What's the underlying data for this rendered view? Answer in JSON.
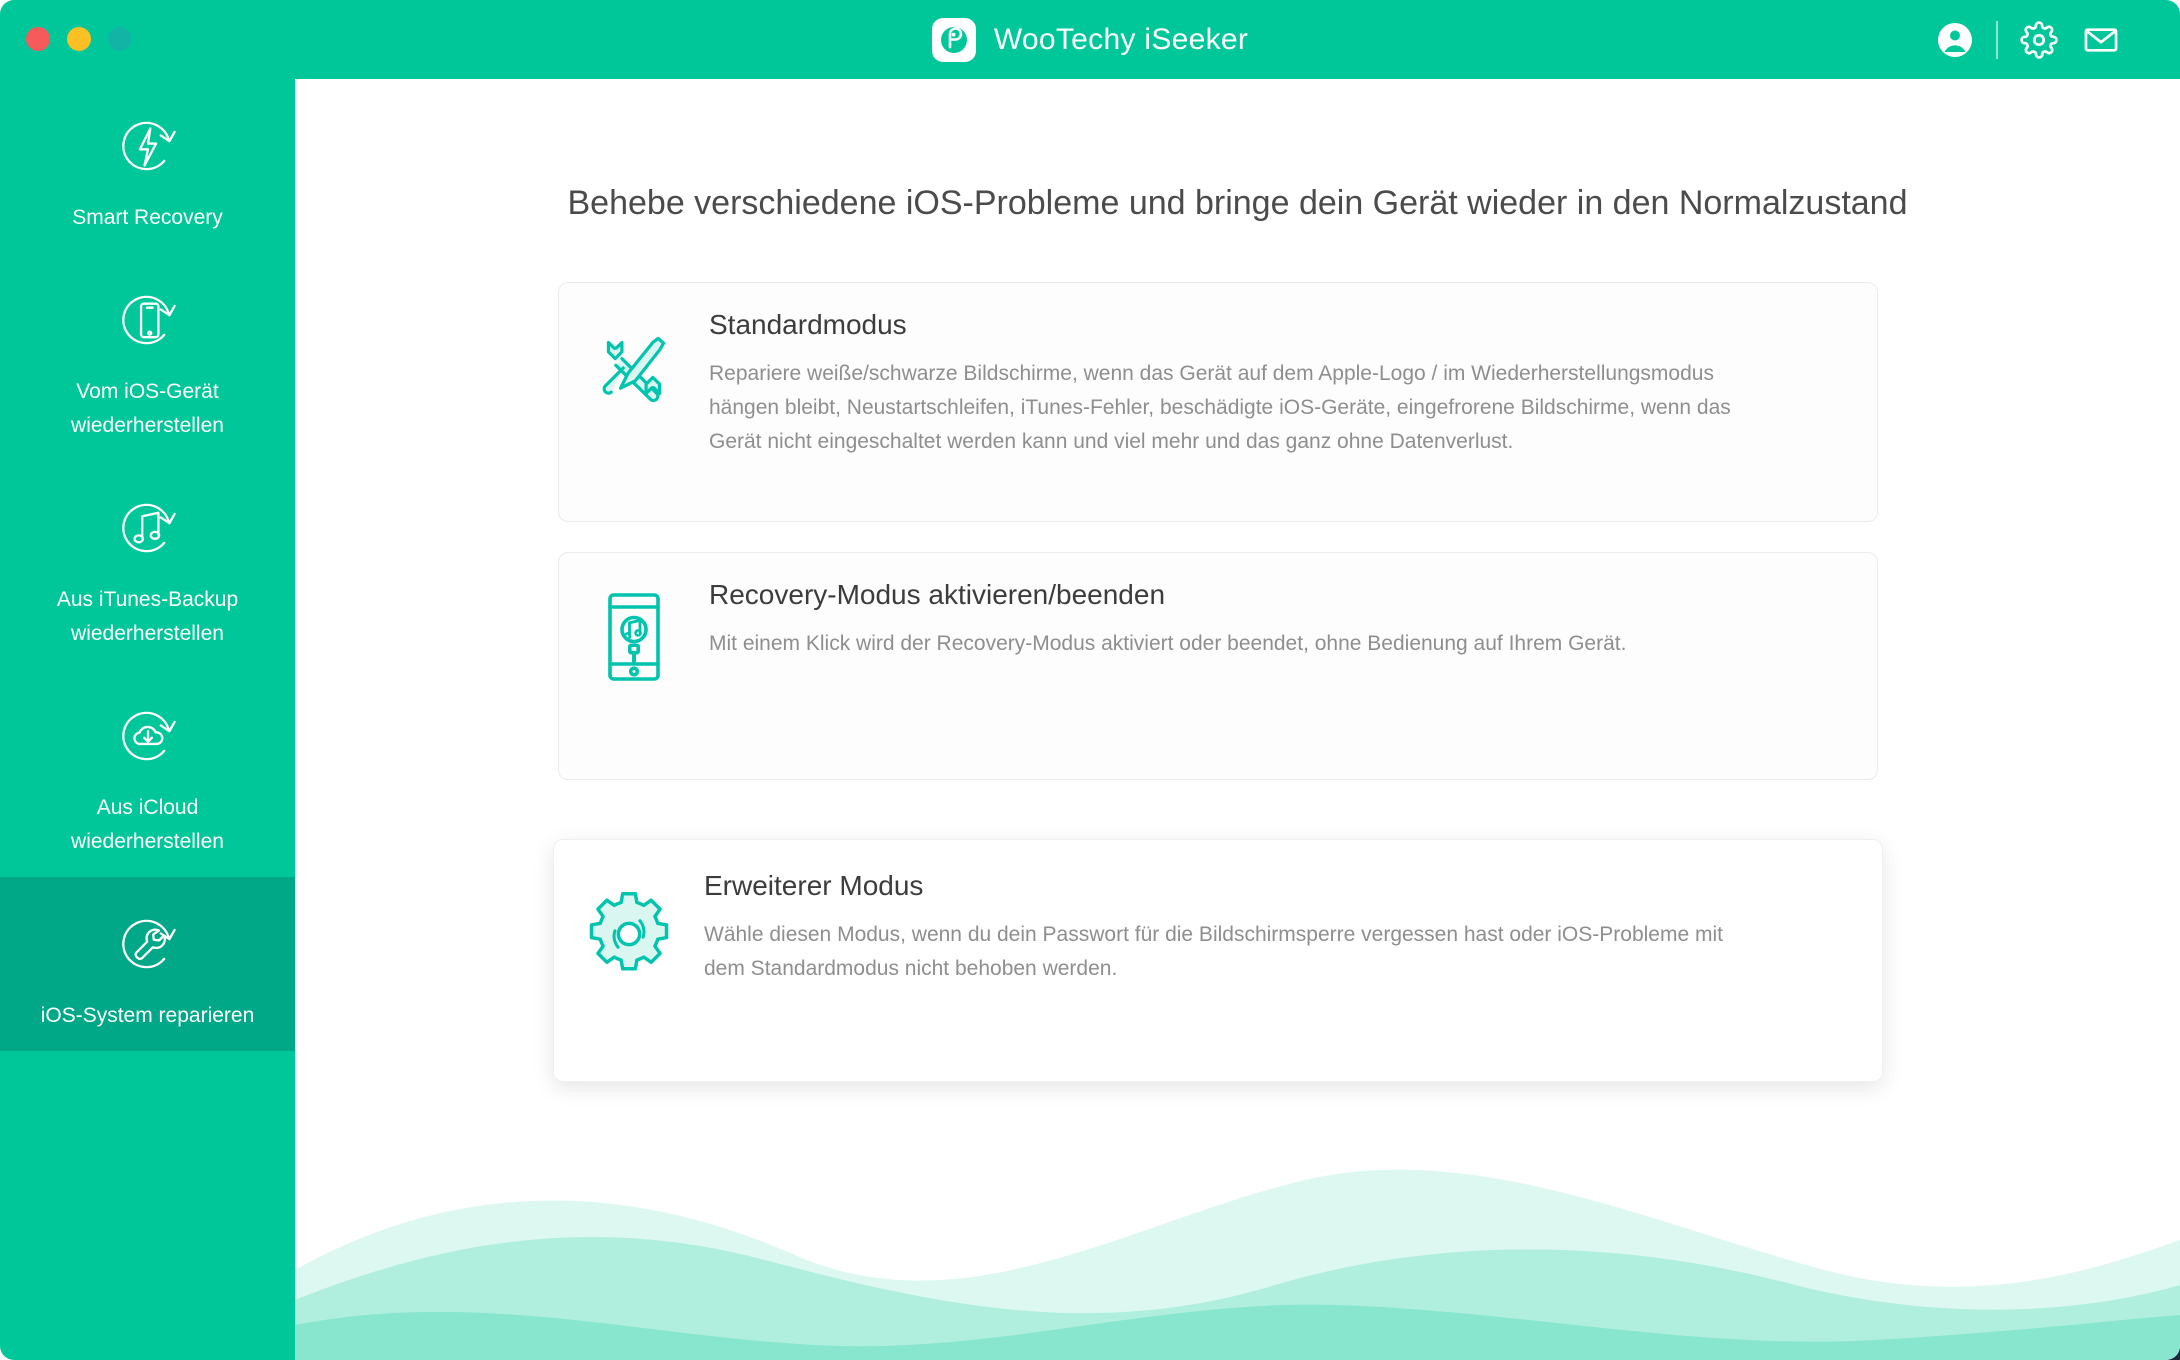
{
  "window": {
    "traffic_lights": [
      {
        "name": "close",
        "color": "#f75a5a"
      },
      {
        "name": "minimize",
        "color": "#fcc024"
      },
      {
        "name": "maximize",
        "color": "#12b5a5"
      }
    ],
    "accent_color": "#00c79a",
    "accent_active_color": "#00a887"
  },
  "titlebar": {
    "app_title": "WooTechy iSeeker",
    "actions": [
      {
        "name": "account",
        "icon": "user-circle-icon"
      },
      {
        "name": "settings",
        "icon": "gear-icon"
      },
      {
        "name": "feedback",
        "icon": "envelope-icon"
      }
    ]
  },
  "sidebar": {
    "items": [
      {
        "label": "Smart Recovery",
        "icon": "lightning-refresh-icon",
        "active": false
      },
      {
        "label": "Vom iOS-Gerät wiederherstellen",
        "icon": "phone-refresh-icon",
        "active": false
      },
      {
        "label": "Aus iTunes-Backup wiederherstellen",
        "icon": "music-refresh-icon",
        "active": false
      },
      {
        "label": "Aus iCloud wiederherstellen",
        "icon": "cloud-download-refresh-icon",
        "active": false
      },
      {
        "label": "iOS-System reparieren",
        "icon": "wrench-refresh-icon",
        "active": true
      }
    ]
  },
  "main": {
    "page_title": "Behebe verschiedene iOS-Probleme und bringe dein Gerät wieder in den Normalzustand",
    "cards": [
      {
        "id": "standard-mode",
        "icon": "wrench-screwdriver-icon",
        "title": "Standardmodus",
        "description": "Repariere weiße/schwarze Bildschirme, wenn das Gerät auf dem Apple-Logo / im Wiederherstellungsmodus hängen bleibt, Neustartschleifen, iTunes-Fehler, beschädigte iOS-Geräte, eingefrorene Bildschirme, wenn das Gerät nicht eingeschaltet werden kann und viel mehr und das ganz ohne Datenverlust."
      },
      {
        "id": "recovery-mode",
        "icon": "phone-itunes-cable-icon",
        "title": "Recovery-Modus aktivieren/beenden",
        "description": "Mit einem Klick wird der Recovery-Modus aktiviert oder beendet, ohne Bedienung auf Ihrem Gerät."
      },
      {
        "id": "advanced-mode",
        "icon": "gear-settings-icon",
        "title": "Erweiterer Modus",
        "description": "Wähle diesen Modus, wenn du dein Passwort für die Bildschirmsperre vergessen hast oder iOS-Probleme mit dem Standardmodus nicht behoben werden."
      }
    ]
  }
}
